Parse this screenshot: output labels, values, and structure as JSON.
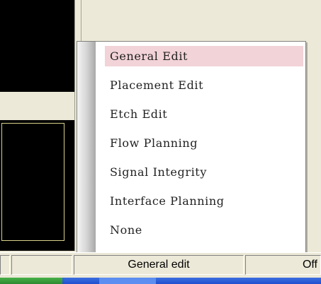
{
  "menu": {
    "items": [
      {
        "label": "General Edit",
        "selected": true
      },
      {
        "label": "Placement Edit",
        "selected": false
      },
      {
        "label": "Etch Edit",
        "selected": false
      },
      {
        "label": "Flow Planning",
        "selected": false
      },
      {
        "label": "Signal Integrity",
        "selected": false
      },
      {
        "label": "Interface Planning",
        "selected": false
      },
      {
        "label": "None",
        "selected": false
      }
    ],
    "highlight_color": "#f2d3d7"
  },
  "statusbar": {
    "mode": "General edit",
    "state": "Off"
  }
}
